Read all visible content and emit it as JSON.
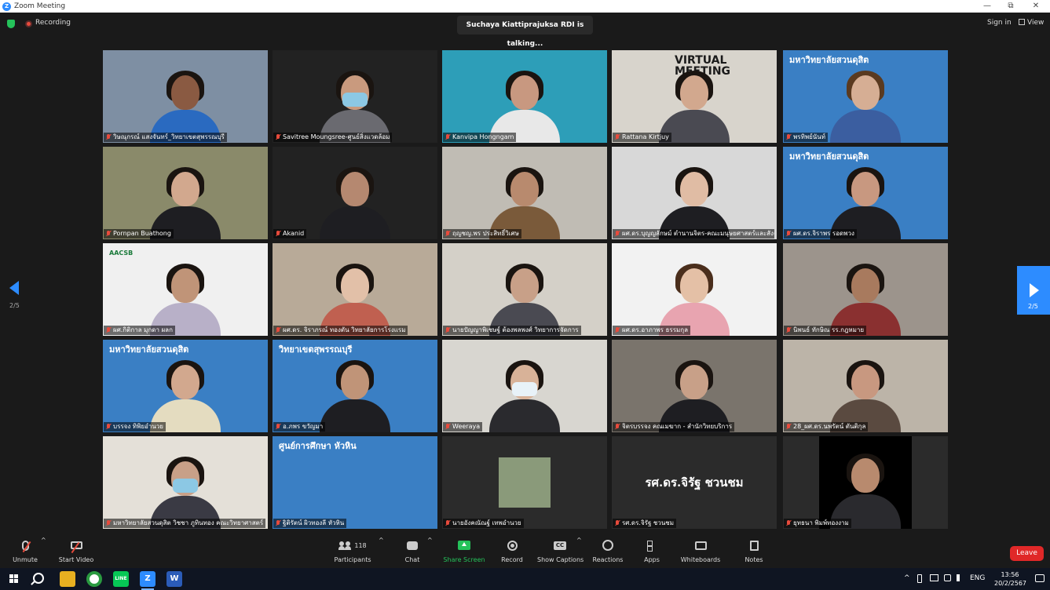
{
  "window": {
    "title": "Zoom Meeting",
    "minimize": "—",
    "restore": "⧉",
    "close": "✕"
  },
  "topbar": {
    "recording_label": "Recording",
    "talking_banner": "Suchaya Kiattiprajuksa RDI is talking...",
    "sign_in": "Sign in",
    "view": "View"
  },
  "colors": {
    "accent": "#2d8cff",
    "active_speaker": "#ffe000",
    "leave": "#e02828",
    "share": "#25c25a",
    "mic_off": "#e84b3c"
  },
  "pager": {
    "left_label": "2/5",
    "right_label": "2/5"
  },
  "tiles": [
    {
      "name": "วิษณุกรณ์ แสงจันทร์_วิทยาเขตสุพรรณบุรี",
      "bg": "#7e8fa3",
      "skin": "#8a5a42",
      "shirt": "#2a6ac0",
      "hair": "#1a1410"
    },
    {
      "name": "Savitree Moungsree-ศูนย์สิ่งแวดล้อม",
      "bg": "#222222",
      "skin": "#c99a7e",
      "shirt": "#6a6a70",
      "hair": "#1a1410",
      "mask": true
    },
    {
      "name": "Kanvipa Hongngam",
      "bg": "#2d9eb8",
      "skin": "#c89880",
      "shirt": "#e8e8e8",
      "hair": "#1a1410"
    },
    {
      "name": "Rattana Kirtjuy",
      "bg": "#d8d4cc",
      "skin": "#d2a88e",
      "shirt": "#4a4a52",
      "hair": "#1a1410",
      "text": "VIRTUAL MEETING"
    },
    {
      "name": "พรทิพย์นันท์",
      "bg": "#3a7fc4",
      "skin": "#d6ae94",
      "shirt": "#3b5ea0",
      "hair": "#5a3a20",
      "text": "มหาวิทยาลัยสวนดุสิต"
    },
    {
      "name": "Pornpan Buathong",
      "bg": "#8a8a6a",
      "skin": "#d2a88e",
      "shirt": "#1e1e22",
      "hair": "#1a1410"
    },
    {
      "name": "Akanid",
      "bg": "#222222",
      "skin": "#b58870",
      "shirt": "#1e1e22",
      "hair": "#1a1410"
    },
    {
      "name": "ฤญชญ.พร ประสิทธิ์วิเศษ",
      "bg": "#c0bcb4",
      "skin": "#b88a6e",
      "shirt": "#7a5a3a",
      "hair": "#1a1410"
    },
    {
      "name": "ผศ.ดร.บุญญลักษม์ ตำนานจิตร-คณะมนุษยศาสตร์และสังคม",
      "bg": "#d8d8d8",
      "skin": "#e0bca4",
      "shirt": "#1e1e22",
      "hair": "#1a1410"
    },
    {
      "name": "ผศ.ดร.จิราพร รอดพวง",
      "bg": "#3a7fc4",
      "skin": "#c89880",
      "shirt": "#1e1e22",
      "hair": "#1a1410",
      "text": "มหาวิทยาลัยสวนดุสิต"
    },
    {
      "name": "ผศ.กิติกาล มุกดา ผลก",
      "bg": "#f0f0f0",
      "skin": "#c09478",
      "shirt": "#b8b0c8",
      "hair": "#1a1410",
      "text": "AACSB"
    },
    {
      "name": "ผศ.ดร. จิราภรณ์ ทองตัน วิทยาลัยการโรงแรม",
      "bg": "#b8aa98",
      "skin": "#e2c0a8",
      "shirt": "#c06050",
      "hair": "#1a1410"
    },
    {
      "name": "นายปัญญาพิเชษฐ์ ต้องพลพงศ์ วิทยาการจัดการ",
      "bg": "#d4d0c8",
      "skin": "#c8a088",
      "shirt": "#4a4a52",
      "hair": "#1a1410"
    },
    {
      "name": "ผศ.ดร.อาภาพร ธรรมกุล",
      "bg": "#f2f2f2",
      "skin": "#e4c0a6",
      "shirt": "#e8a4b0",
      "hair": "#4a2e1c"
    },
    {
      "name": "นิพนธ์ ทักษิณ รร.กฎหมาย",
      "bg": "#9c948c",
      "skin": "#a87a5e",
      "shirt": "#8a3030",
      "hair": "#1a1410"
    },
    {
      "name": "บรรจง ทิพิยอำนวย",
      "bg": "#3a7fc4",
      "skin": "#d2a88e",
      "shirt": "#e4dcc0",
      "hair": "#1a1410",
      "text": "มหาวิทยาลัยสวนดุสิต"
    },
    {
      "name": "อ.ภพร ขวัญมา",
      "bg": "#3a7fc4",
      "skin": "#c09478",
      "shirt": "#1e1e22",
      "hair": "#1a1410",
      "text": "วิทยาเขตสุพรรณบุรี"
    },
    {
      "name": "Weeraya",
      "bg": "#d8d6d0",
      "skin": "#d8b298",
      "shirt": "#2a2a2e",
      "hair": "#1a1410",
      "mask": true
    },
    {
      "name": "จิตรบรรจง คณเมฆาก - สำนักวิทยบริการ",
      "bg": "#7a746c",
      "skin": "#c8a088",
      "shirt": "#1e1e22",
      "hair": "#1a1410"
    },
    {
      "name": "28_ผศ.ดร.นพรัตน์ ตันติกุล",
      "bg": "#bcb4a8",
      "skin": "#c89880",
      "shirt": "#5a4a40",
      "hair": "#1a1410"
    },
    {
      "name": "มหาวิทยาลัยสวนดุสิต วิชชา ภูทินทอง คณะวิทยาศาสตร์",
      "bg": "#e4e0d8",
      "skin": "#c8a088",
      "shirt": "#3a3a44",
      "hair": "#1a1410",
      "mask": true
    },
    {
      "name": "ฐิติรัตน์ ผิวทองลี หัวหิน",
      "bg": "#3a7fc4",
      "skin": "#c8a088",
      "shirt": "#3a3a44",
      "hair": "#1a1410",
      "text": "ศูนย์การศึกษา หัวหิน",
      "nobody": true
    },
    {
      "name": "นายอังคณัณฐ์ เทพอำนวย",
      "bg": "#2b2b2b",
      "skin": "#c8a088",
      "shirt": "#3a3a44",
      "hair": "#1a1410",
      "nobody": true,
      "small_photo": true
    },
    {
      "name": "รศ.ดร.จิรัฐ ชวนชม",
      "bg": "#2b2b2b",
      "textavatar": "รศ.ดร.จิรัฐ ชวนชม"
    },
    {
      "name": "ยุทธนา พิมพ์ทองงาม",
      "bg": "#2b2b2b",
      "skin": "#b88a6e",
      "shirt": "#2a2a2e",
      "hair": "#1a1410",
      "portrait": true
    }
  ],
  "toolbar": {
    "unmute": "Unmute",
    "start_video": "Start Video",
    "participants": "Participants",
    "participant_count": "118",
    "chat": "Chat",
    "share_screen": "Share Screen",
    "record": "Record",
    "show_captions": "Show Captions",
    "reactions": "Reactions",
    "apps": "Apps",
    "whiteboards": "Whiteboards",
    "notes": "Notes",
    "leave": "Leave",
    "caret": "^"
  },
  "taskbar": {
    "lang": "ENG",
    "time": "13:56",
    "date": "20/2/2567",
    "line_app": "LINE",
    "zoom_app": "Z",
    "word_app": "W",
    "tray_chevron": "^"
  }
}
